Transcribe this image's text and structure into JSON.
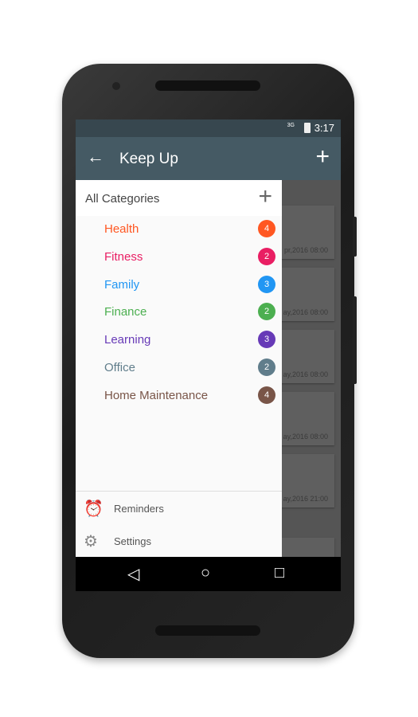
{
  "status": {
    "network": "3G",
    "time": "3:17"
  },
  "toolbar": {
    "title": "Keep Up"
  },
  "drawer": {
    "header": "All Categories",
    "categories": [
      {
        "name": "Health",
        "count": "4",
        "color": "#ff5722"
      },
      {
        "name": "Fitness",
        "count": "2",
        "color": "#e91e63"
      },
      {
        "name": "Family",
        "count": "3",
        "color": "#2196f3"
      },
      {
        "name": "Finance",
        "count": "2",
        "color": "#4caf50"
      },
      {
        "name": "Learning",
        "count": "3",
        "color": "#673ab7"
      },
      {
        "name": "Office",
        "count": "2",
        "color": "#607d8b"
      },
      {
        "name": "Home Maintenance",
        "count": "4",
        "color": "#795548"
      }
    ],
    "footer": [
      {
        "label": "Reminders",
        "icon": "alarm-icon"
      },
      {
        "label": "Settings",
        "icon": "gear-icon"
      }
    ]
  },
  "background_cards": [
    "pr,2016  08:00",
    "ay,2016  08:00",
    "ay,2016  08:00",
    "ay,2016  08:00",
    "ay,2016  21:00"
  ]
}
